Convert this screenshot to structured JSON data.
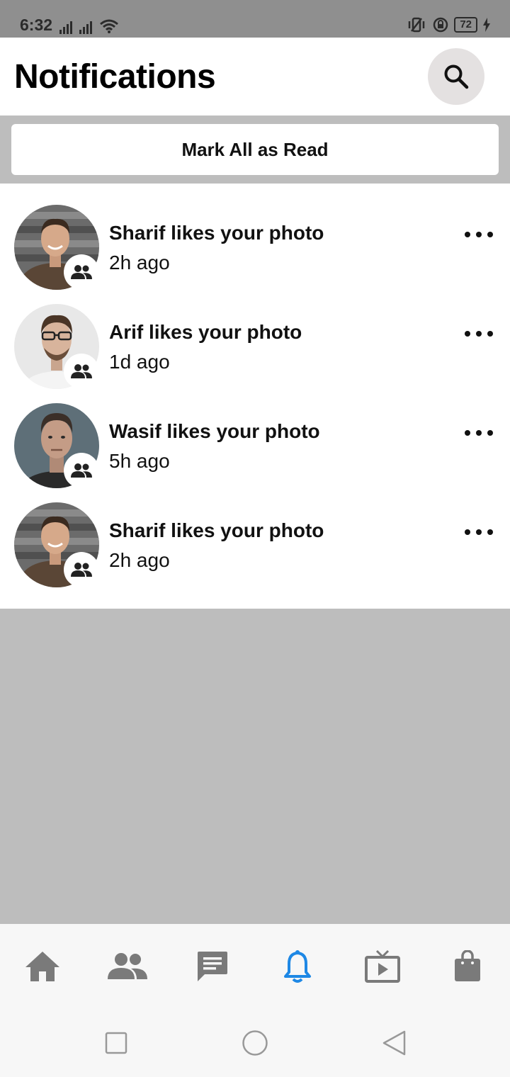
{
  "status_bar": {
    "time": "6:32",
    "battery": "72"
  },
  "header": {
    "title": "Notifications",
    "search_icon": "search-icon"
  },
  "actions": {
    "mark_all_label": "Mark All as Read"
  },
  "notifications": [
    {
      "text": "Sharif likes your photo",
      "time": "2h ago",
      "avatar": "Sharif",
      "badge_icon": "friends-icon"
    },
    {
      "text": "Arif likes your photo",
      "time": "1d ago",
      "avatar": "Arif",
      "badge_icon": "friends-icon"
    },
    {
      "text": "Wasif likes your photo",
      "time": "5h ago",
      "avatar": "Wasif",
      "badge_icon": "friends-icon"
    },
    {
      "text": "Sharif likes your photo",
      "time": "2h ago",
      "avatar": "Sharif",
      "badge_icon": "friends-icon"
    }
  ],
  "bottom_nav": {
    "items": [
      "home-icon",
      "friends-icon",
      "messages-icon",
      "notifications-icon",
      "watch-icon",
      "marketplace-icon"
    ],
    "active": "notifications-icon",
    "active_color": "#1e88e5",
    "inactive_color": "#7a7a7a"
  },
  "system_nav": [
    "recents-icon",
    "home-circle-icon",
    "back-icon"
  ]
}
